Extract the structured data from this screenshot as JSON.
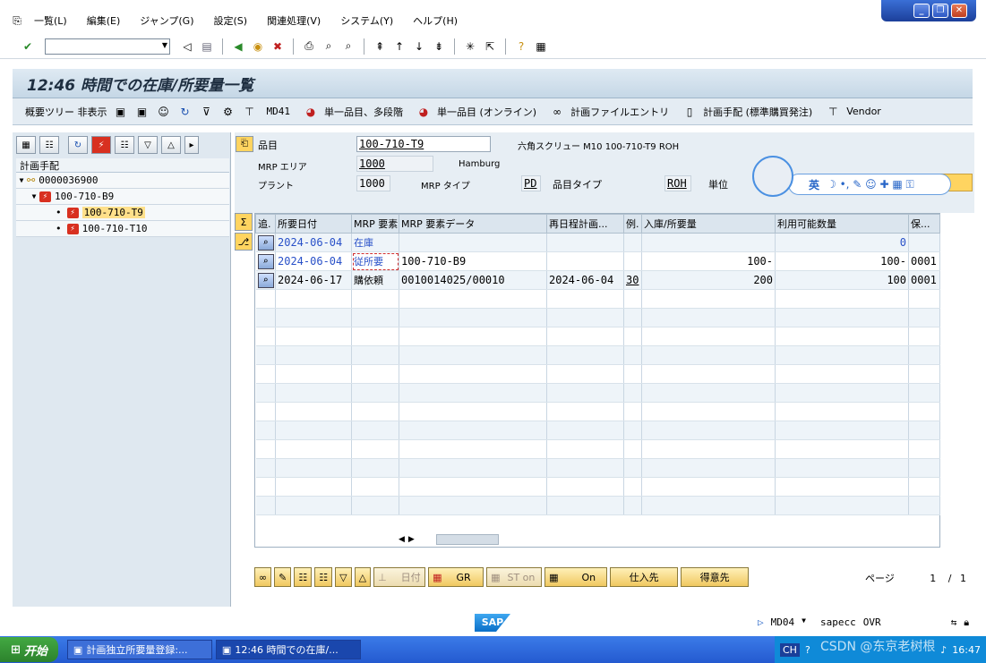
{
  "menu": [
    "一覧(L)",
    "編集(E)",
    "ジャンプ(G)",
    "設定(S)",
    "関連処理(V)",
    "システム(Y)",
    "ヘルプ(H)"
  ],
  "window_controls": {
    "minimize": "_",
    "restore": "❐",
    "close": "✕"
  },
  "title": "12:46 時間での在庫/所要量一覧",
  "app_toolbar": {
    "hide_tree": "概要ツリー 非表示",
    "md41": "MD41",
    "single_multi": "単一品目、多段階",
    "single_online": "単一品目 (オンライン)",
    "plan_file": "計画ファイルエントリ",
    "proc_type": "計画手配 (標準購買発注)",
    "vendor": "Vendor"
  },
  "tree": {
    "header": "計画手配",
    "nodes": [
      "0000036900",
      "100-710-B9",
      "100-710-T9",
      "100-710-T10"
    ]
  },
  "header": {
    "material_label": "品目",
    "material": "100-710-T9",
    "material_desc": "六角スクリュー M10 100-710-T9 ROH",
    "mrp_area_label": "MRP エリア",
    "mrp_area": "1000",
    "mrp_area_desc": "Hamburg",
    "plant_label": "プラント",
    "plant": "1000",
    "mrp_type_label": "MRP タイプ",
    "mrp_type": "PD",
    "mat_type_label": "品目タイプ",
    "mat_type": "ROH",
    "unit_label": "単位"
  },
  "ime": {
    "lang": "英",
    "symbols": "☽ •, ✎ ☺ ✚ ▦ ⚿"
  },
  "grid": {
    "columns": [
      "追.",
      "所要日付",
      "MRP 要素",
      "MRP 要素データ",
      "再日程計画...",
      "例.",
      "入庫/所要量",
      "利用可能数量",
      "保..."
    ],
    "rows": [
      {
        "date": "2024-06-04",
        "elem": "在庫",
        "data": "",
        "resched": "",
        "exc": "",
        "qty": "",
        "avail": "0",
        "stor": ""
      },
      {
        "date": "2024-06-04",
        "elem": "従所要",
        "data": "100-710-B9",
        "resched": "",
        "exc": "",
        "qty": "100-",
        "avail": "100-",
        "stor": "0001"
      },
      {
        "date": "2024-06-17",
        "elem": "購依頼",
        "data": "0010014025/00010",
        "resched": "2024-06-04",
        "exc": "30",
        "qty": "200",
        "avail": "100",
        "stor": "0001"
      }
    ]
  },
  "bottom_buttons": {
    "date": "日付",
    "gr": "GR",
    "st": "ST on",
    "on": "On",
    "vendor": "仕入先",
    "customer": "得意先"
  },
  "paging": {
    "label": "ページ",
    "current": "1",
    "sep": "/",
    "total": "1"
  },
  "status": {
    "tcode": "MD04",
    "system": "sapecc",
    "mode": "OVR",
    "sap_logo": "SAP"
  },
  "taskbar": {
    "start": "开始",
    "tasks": [
      "計画独立所要量登録:...",
      "12:46 時間での在庫/..."
    ],
    "lang": "CH",
    "clock": "16:47",
    "watermark": "CSDN @东京老树根"
  }
}
